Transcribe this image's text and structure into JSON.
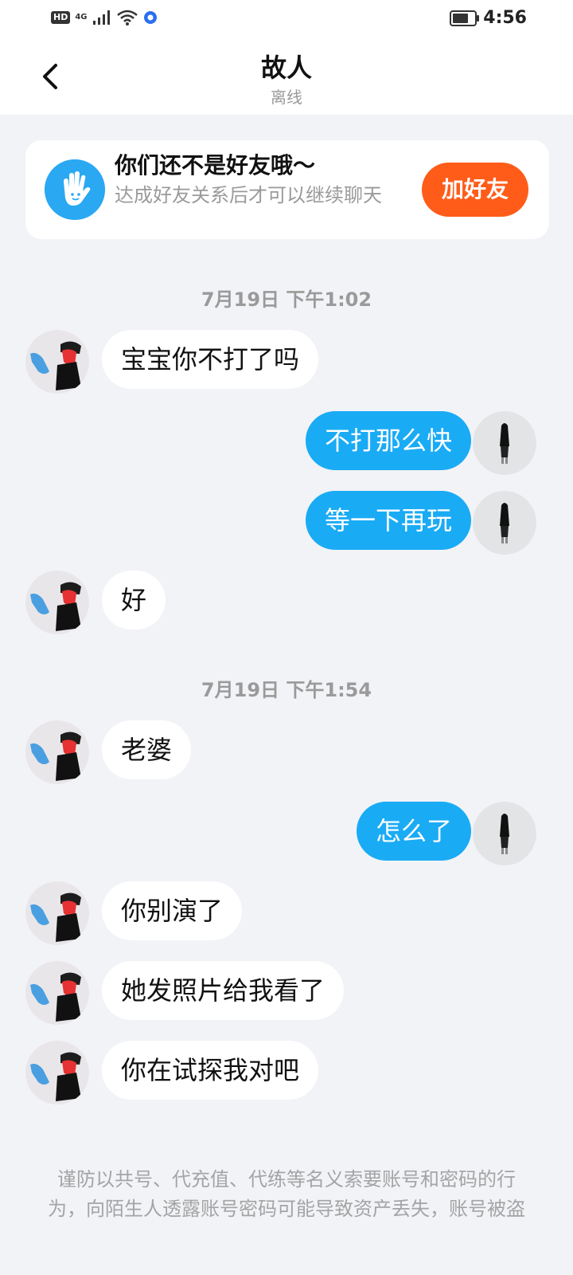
{
  "status_bar": {
    "network_badge": "HD",
    "network_type": "4G",
    "time": "4:56",
    "battery_level": 0.72
  },
  "header": {
    "title": "故人",
    "subtitle": "离线"
  },
  "friend_banner": {
    "heading": "你们还不是好友哦～",
    "body": "达成好友关系后才可以继续聊天",
    "button_label": "加好友",
    "accent": "#ff5c1a"
  },
  "messages": {
    "stamp_1": "7月19日 下午1:02",
    "m1": "宝宝你不打了吗",
    "m2": "不打那么快",
    "m3": "等一下再玩",
    "m4": "好",
    "stamp_2": "7月19日 下午1:54",
    "m5": "老婆",
    "m6": "怎么了",
    "m7": "你别演了",
    "m8": "她发照片给我看了",
    "m9": "你在试探我对吧"
  },
  "footer": {
    "warning": "谨防以共号、代充值、代练等名义索要账号和密码的行为，向陌生人透露账号密码可能导致资产丢失，账号被盗"
  },
  "colors": {
    "outgoing_bubble": "#1aabf5",
    "incoming_bubble": "#ffffff",
    "background": "#f2f3f7"
  }
}
